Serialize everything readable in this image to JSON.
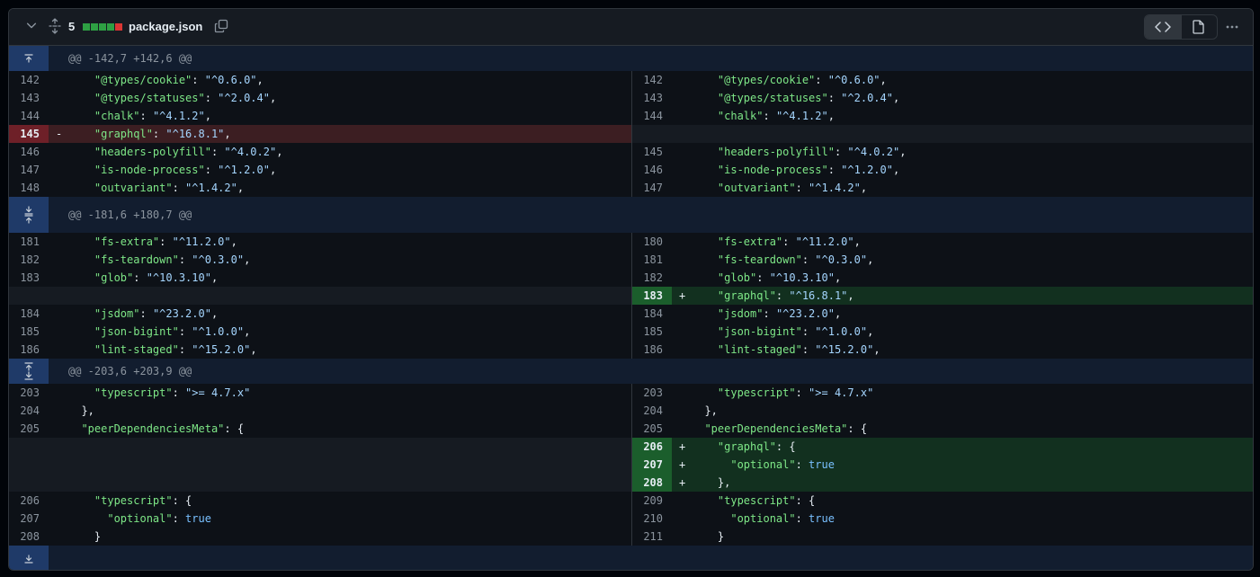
{
  "file": {
    "additions_count": "5",
    "name": "package.json",
    "diffstat_colors": [
      "#2ea043",
      "#2ea043",
      "#2ea043",
      "#2ea043",
      "#da3633"
    ]
  },
  "icons": {
    "collapse": "chevron-down-icon",
    "expand_all": "unfold-icon",
    "copy": "copy-icon",
    "code_view": "code-icon",
    "file_view": "file-icon",
    "more": "kebab-horizontal-icon",
    "expand_up": "expand-up-icon",
    "expand_down": "expand-down-icon"
  },
  "rows": [
    {
      "type": "hunk",
      "text": "@@ -142,7 +142,6 @@",
      "expand": "up"
    },
    {
      "type": "line",
      "l": {
        "n": "142",
        "kind": "ctx",
        "code": [
          [
            "k",
            "    \"@types/cookie\""
          ],
          [
            "p",
            ": "
          ],
          [
            "s",
            "\"^0.6.0\""
          ],
          [
            "p",
            ","
          ]
        ]
      },
      "r": {
        "n": "142",
        "kind": "ctx",
        "code": [
          [
            "k",
            "    \"@types/cookie\""
          ],
          [
            "p",
            ": "
          ],
          [
            "s",
            "\"^0.6.0\""
          ],
          [
            "p",
            ","
          ]
        ]
      }
    },
    {
      "type": "line",
      "l": {
        "n": "143",
        "kind": "ctx",
        "code": [
          [
            "k",
            "    \"@types/statuses\""
          ],
          [
            "p",
            ": "
          ],
          [
            "s",
            "\"^2.0.4\""
          ],
          [
            "p",
            ","
          ]
        ]
      },
      "r": {
        "n": "143",
        "kind": "ctx",
        "code": [
          [
            "k",
            "    \"@types/statuses\""
          ],
          [
            "p",
            ": "
          ],
          [
            "s",
            "\"^2.0.4\""
          ],
          [
            "p",
            ","
          ]
        ]
      }
    },
    {
      "type": "line",
      "l": {
        "n": "144",
        "kind": "ctx",
        "code": [
          [
            "k",
            "    \"chalk\""
          ],
          [
            "p",
            ": "
          ],
          [
            "s",
            "\"^4.1.2\""
          ],
          [
            "p",
            ","
          ]
        ]
      },
      "r": {
        "n": "144",
        "kind": "ctx",
        "code": [
          [
            "k",
            "    \"chalk\""
          ],
          [
            "p",
            ": "
          ],
          [
            "s",
            "\"^4.1.2\""
          ],
          [
            "p",
            ","
          ]
        ]
      }
    },
    {
      "type": "line",
      "l": {
        "n": "145",
        "kind": "del",
        "marker": "-",
        "code": [
          [
            "k",
            "    \"graphql\""
          ],
          [
            "p",
            ": "
          ],
          [
            "s",
            "\"^16.8.1\""
          ],
          [
            "p",
            ","
          ]
        ]
      },
      "r": {
        "kind": "empty"
      }
    },
    {
      "type": "line",
      "l": {
        "n": "146",
        "kind": "ctx",
        "code": [
          [
            "k",
            "    \"headers-polyfill\""
          ],
          [
            "p",
            ": "
          ],
          [
            "s",
            "\"^4.0.2\""
          ],
          [
            "p",
            ","
          ]
        ]
      },
      "r": {
        "n": "145",
        "kind": "ctx",
        "code": [
          [
            "k",
            "    \"headers-polyfill\""
          ],
          [
            "p",
            ": "
          ],
          [
            "s",
            "\"^4.0.2\""
          ],
          [
            "p",
            ","
          ]
        ]
      }
    },
    {
      "type": "line",
      "l": {
        "n": "147",
        "kind": "ctx",
        "code": [
          [
            "k",
            "    \"is-node-process\""
          ],
          [
            "p",
            ": "
          ],
          [
            "s",
            "\"^1.2.0\""
          ],
          [
            "p",
            ","
          ]
        ]
      },
      "r": {
        "n": "146",
        "kind": "ctx",
        "code": [
          [
            "k",
            "    \"is-node-process\""
          ],
          [
            "p",
            ": "
          ],
          [
            "s",
            "\"^1.2.0\""
          ],
          [
            "p",
            ","
          ]
        ]
      }
    },
    {
      "type": "line",
      "l": {
        "n": "148",
        "kind": "ctx",
        "code": [
          [
            "k",
            "    \"outvariant\""
          ],
          [
            "p",
            ": "
          ],
          [
            "s",
            "\"^1.4.2\""
          ],
          [
            "p",
            ","
          ]
        ]
      },
      "r": {
        "n": "147",
        "kind": "ctx",
        "code": [
          [
            "k",
            "    \"outvariant\""
          ],
          [
            "p",
            ": "
          ],
          [
            "s",
            "\"^1.4.2\""
          ],
          [
            "p",
            ","
          ]
        ]
      }
    },
    {
      "type": "hunk",
      "text": "@@ -181,6 +180,7 @@",
      "expand": "both"
    },
    {
      "type": "line",
      "l": {
        "n": "181",
        "kind": "ctx",
        "code": [
          [
            "k",
            "    \"fs-extra\""
          ],
          [
            "p",
            ": "
          ],
          [
            "s",
            "\"^11.2.0\""
          ],
          [
            "p",
            ","
          ]
        ]
      },
      "r": {
        "n": "180",
        "kind": "ctx",
        "code": [
          [
            "k",
            "    \"fs-extra\""
          ],
          [
            "p",
            ": "
          ],
          [
            "s",
            "\"^11.2.0\""
          ],
          [
            "p",
            ","
          ]
        ]
      }
    },
    {
      "type": "line",
      "l": {
        "n": "182",
        "kind": "ctx",
        "code": [
          [
            "k",
            "    \"fs-teardown\""
          ],
          [
            "p",
            ": "
          ],
          [
            "s",
            "\"^0.3.0\""
          ],
          [
            "p",
            ","
          ]
        ]
      },
      "r": {
        "n": "181",
        "kind": "ctx",
        "code": [
          [
            "k",
            "    \"fs-teardown\""
          ],
          [
            "p",
            ": "
          ],
          [
            "s",
            "\"^0.3.0\""
          ],
          [
            "p",
            ","
          ]
        ]
      }
    },
    {
      "type": "line",
      "l": {
        "n": "183",
        "kind": "ctx",
        "code": [
          [
            "k",
            "    \"glob\""
          ],
          [
            "p",
            ": "
          ],
          [
            "s",
            "\"^10.3.10\""
          ],
          [
            "p",
            ","
          ]
        ]
      },
      "r": {
        "n": "182",
        "kind": "ctx",
        "code": [
          [
            "k",
            "    \"glob\""
          ],
          [
            "p",
            ": "
          ],
          [
            "s",
            "\"^10.3.10\""
          ],
          [
            "p",
            ","
          ]
        ]
      }
    },
    {
      "type": "line",
      "l": {
        "kind": "empty"
      },
      "r": {
        "n": "183",
        "kind": "add",
        "marker": "+",
        "code": [
          [
            "k",
            "    \"graphql\""
          ],
          [
            "p",
            ": "
          ],
          [
            "s",
            "\"^16.8.1\""
          ],
          [
            "p",
            ","
          ]
        ]
      }
    },
    {
      "type": "line",
      "l": {
        "n": "184",
        "kind": "ctx",
        "code": [
          [
            "k",
            "    \"jsdom\""
          ],
          [
            "p",
            ": "
          ],
          [
            "s",
            "\"^23.2.0\""
          ],
          [
            "p",
            ","
          ]
        ]
      },
      "r": {
        "n": "184",
        "kind": "ctx",
        "code": [
          [
            "k",
            "    \"jsdom\""
          ],
          [
            "p",
            ": "
          ],
          [
            "s",
            "\"^23.2.0\""
          ],
          [
            "p",
            ","
          ]
        ]
      }
    },
    {
      "type": "line",
      "l": {
        "n": "185",
        "kind": "ctx",
        "code": [
          [
            "k",
            "    \"json-bigint\""
          ],
          [
            "p",
            ": "
          ],
          [
            "s",
            "\"^1.0.0\""
          ],
          [
            "p",
            ","
          ]
        ]
      },
      "r": {
        "n": "185",
        "kind": "ctx",
        "code": [
          [
            "k",
            "    \"json-bigint\""
          ],
          [
            "p",
            ": "
          ],
          [
            "s",
            "\"^1.0.0\""
          ],
          [
            "p",
            ","
          ]
        ]
      }
    },
    {
      "type": "line",
      "l": {
        "n": "186",
        "kind": "ctx",
        "code": [
          [
            "k",
            "    \"lint-staged\""
          ],
          [
            "p",
            ": "
          ],
          [
            "s",
            "\"^15.2.0\""
          ],
          [
            "p",
            ","
          ]
        ]
      },
      "r": {
        "n": "186",
        "kind": "ctx",
        "code": [
          [
            "k",
            "    \"lint-staged\""
          ],
          [
            "p",
            ": "
          ],
          [
            "s",
            "\"^15.2.0\""
          ],
          [
            "p",
            ","
          ]
        ]
      }
    },
    {
      "type": "hunk",
      "text": "@@ -203,6 +203,9 @@",
      "expand": "unfold"
    },
    {
      "type": "line",
      "l": {
        "n": "203",
        "kind": "ctx",
        "code": [
          [
            "k",
            "    \"typescript\""
          ],
          [
            "p",
            ": "
          ],
          [
            "s",
            "\">= 4.7.x\""
          ]
        ]
      },
      "r": {
        "n": "203",
        "kind": "ctx",
        "code": [
          [
            "k",
            "    \"typescript\""
          ],
          [
            "p",
            ": "
          ],
          [
            "s",
            "\">= 4.7.x\""
          ]
        ]
      }
    },
    {
      "type": "line",
      "l": {
        "n": "204",
        "kind": "ctx",
        "code": [
          [
            "p",
            "  },"
          ]
        ]
      },
      "r": {
        "n": "204",
        "kind": "ctx",
        "code": [
          [
            "p",
            "  },"
          ]
        ]
      }
    },
    {
      "type": "line",
      "l": {
        "n": "205",
        "kind": "ctx",
        "code": [
          [
            "k",
            "  \"peerDependenciesMeta\""
          ],
          [
            "p",
            ": {"
          ]
        ]
      },
      "r": {
        "n": "205",
        "kind": "ctx",
        "code": [
          [
            "k",
            "  \"peerDependenciesMeta\""
          ],
          [
            "p",
            ": {"
          ]
        ]
      }
    },
    {
      "type": "line",
      "l": {
        "kind": "empty"
      },
      "r": {
        "n": "206",
        "kind": "add",
        "marker": "+",
        "code": [
          [
            "k",
            "    \"graphql\""
          ],
          [
            "p",
            ": {"
          ]
        ]
      }
    },
    {
      "type": "line",
      "l": {
        "kind": "empty"
      },
      "r": {
        "n": "207",
        "kind": "add",
        "marker": "+",
        "code": [
          [
            "k",
            "      \"optional\""
          ],
          [
            "p",
            ": "
          ],
          [
            "b",
            "true"
          ]
        ]
      }
    },
    {
      "type": "line",
      "l": {
        "kind": "empty"
      },
      "r": {
        "n": "208",
        "kind": "add",
        "marker": "+",
        "code": [
          [
            "p",
            "    },"
          ]
        ]
      }
    },
    {
      "type": "line",
      "l": {
        "n": "206",
        "kind": "ctx",
        "code": [
          [
            "k",
            "    \"typescript\""
          ],
          [
            "p",
            ": {"
          ]
        ]
      },
      "r": {
        "n": "209",
        "kind": "ctx",
        "code": [
          [
            "k",
            "    \"typescript\""
          ],
          [
            "p",
            ": {"
          ]
        ]
      }
    },
    {
      "type": "line",
      "l": {
        "n": "207",
        "kind": "ctx",
        "code": [
          [
            "k",
            "      \"optional\""
          ],
          [
            "p",
            ": "
          ],
          [
            "b",
            "true"
          ]
        ]
      },
      "r": {
        "n": "210",
        "kind": "ctx",
        "code": [
          [
            "k",
            "      \"optional\""
          ],
          [
            "p",
            ": "
          ],
          [
            "b",
            "true"
          ]
        ]
      }
    },
    {
      "type": "line",
      "l": {
        "n": "208",
        "kind": "ctx",
        "code": [
          [
            "p",
            "    }"
          ]
        ]
      },
      "r": {
        "n": "211",
        "kind": "ctx",
        "code": [
          [
            "p",
            "    }"
          ]
        ]
      }
    },
    {
      "type": "hunk",
      "text": "",
      "expand": "down"
    }
  ]
}
